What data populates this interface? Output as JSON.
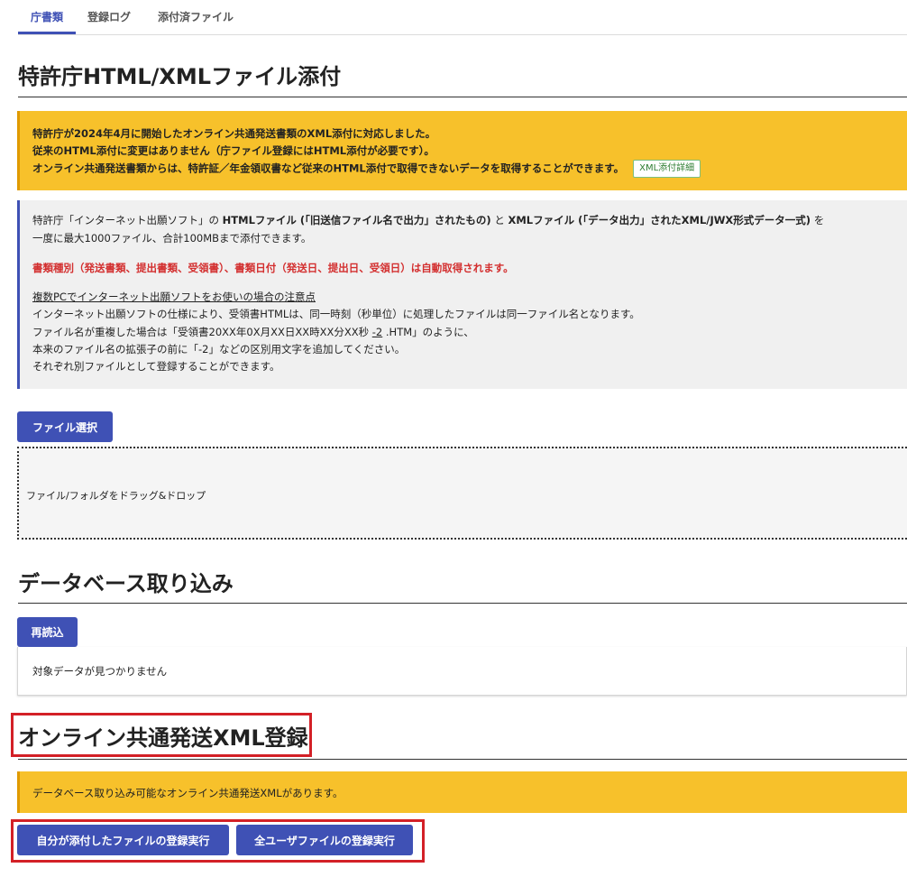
{
  "tabs": [
    {
      "label": "庁書類",
      "active": true
    },
    {
      "label": "登録ログ",
      "active": false
    },
    {
      "label": "添付済ファイル",
      "active": false
    }
  ],
  "section1": {
    "title": "特許庁HTML/XMLファイル添付",
    "notice": {
      "line1": "特許庁が2024年4月に開始したオンライン共通発送書類のXML添付に対応しました。",
      "line2": "従来のHTML添付に変更はありません（庁ファイル登録にはHTML添付が必要です）。",
      "line3": "オンライン共通発送書類からは、特許証／年金領収書など従来のHTML添付で取得できないデータを取得することができます。",
      "detail_button": "XML添付詳細"
    },
    "info": {
      "p1_a": "特許庁「インターネット出願ソフト」の ",
      "p1_b": "HTMLファイル (｢旧送信ファイル名で出力」されたもの)",
      "p1_c": " と ",
      "p1_d": "XMLファイル (｢データ出力」されたXML/JWX形式データ一式)",
      "p1_e": " を",
      "p2": "一度に最大1000ファイル、合計100MBまで添付できます。",
      "auto_note": "書類種別（発送書類、提出書類、受領書）、書類日付（発送日、提出日、受領日）は自動取得されます。",
      "caution_title": "複数PCでインターネット出願ソフトをお使いの場合の注意点",
      "c1": "インターネット出願ソフトの仕様により、受領書HTMLは、同一時刻（秒単位）に処理したファイルは同一ファイル名となります。",
      "c2_a": "ファイル名が重複した場合は「受領書20XX年0X月XX日XX時XX分XX秒 ",
      "c2_b": "-2",
      "c2_c": " .HTM」のように、",
      "c3": "本来のファイル名の拡張子の前に「-2」などの区別用文字を追加してください。",
      "c4": "それぞれ別ファイルとして登録することができます。"
    },
    "file_select_button": "ファイル選択",
    "dropzone_text": "ファイル/フォルダをドラッグ&ドロップ"
  },
  "section2": {
    "title": "データベース取り込み",
    "reload_button": "再読込",
    "empty_text": "対象データが見つかりません"
  },
  "section3": {
    "title": "オンライン共通発送XML登録",
    "notice": "データベース取り込み可能なオンライン共通発送XMLがあります。",
    "register_own_button": "自分が添付したファイルの登録実行",
    "register_all_button": "全ユーザファイルの登録実行"
  },
  "colors": {
    "accent": "#3f51b5",
    "warning": "#f7c12b",
    "error": "#d32f2f",
    "highlight": "#d32027"
  }
}
